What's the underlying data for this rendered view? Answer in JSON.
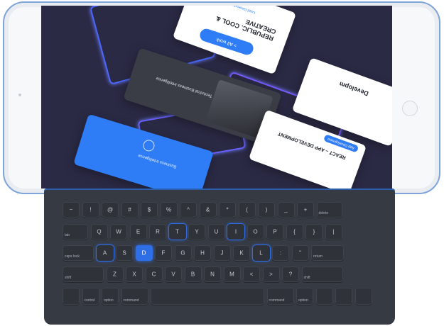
{
  "screen": {
    "button_label": "> All work",
    "card_top_title": "REPUBLIC. COOL & CREATIVE",
    "card_top_tag": "Lead Generation",
    "card_right_title": "Developm",
    "card_mid_bottom_title": "REACT – APP DEVELOPMENT",
    "card_mid_bottom_tag": "App Development",
    "card_blue_title": "Business Intelligence",
    "card_dark_title": "Technical Business Intelligence"
  },
  "keyboard": {
    "row1": [
      "~",
      "!",
      "@",
      "#",
      "$",
      "%",
      "^",
      "&",
      "*",
      "(",
      ")",
      "_",
      "+",
      "delete"
    ],
    "row2": [
      "tab",
      "Q",
      "W",
      "E",
      "R",
      "T",
      "Y",
      "U",
      "I",
      "O",
      "P",
      "{",
      "}",
      "|"
    ],
    "row3": [
      "caps lock",
      "A",
      "S",
      "D",
      "F",
      "G",
      "H",
      "J",
      "K",
      "L",
      ":",
      "\"",
      "return"
    ],
    "row4": [
      "shift",
      "Z",
      "X",
      "C",
      "V",
      "B",
      "N",
      "M",
      "<",
      ">",
      "?",
      "shift"
    ],
    "row5": [
      "",
      "control",
      "option",
      "command",
      "",
      "command",
      "option",
      "",
      "",
      ""
    ]
  },
  "colors": {
    "accent": "#2e6fe8",
    "keyboard": "#363a42",
    "screen_bg": "#2b2a45",
    "frame_outline": "#7fa4d8"
  }
}
